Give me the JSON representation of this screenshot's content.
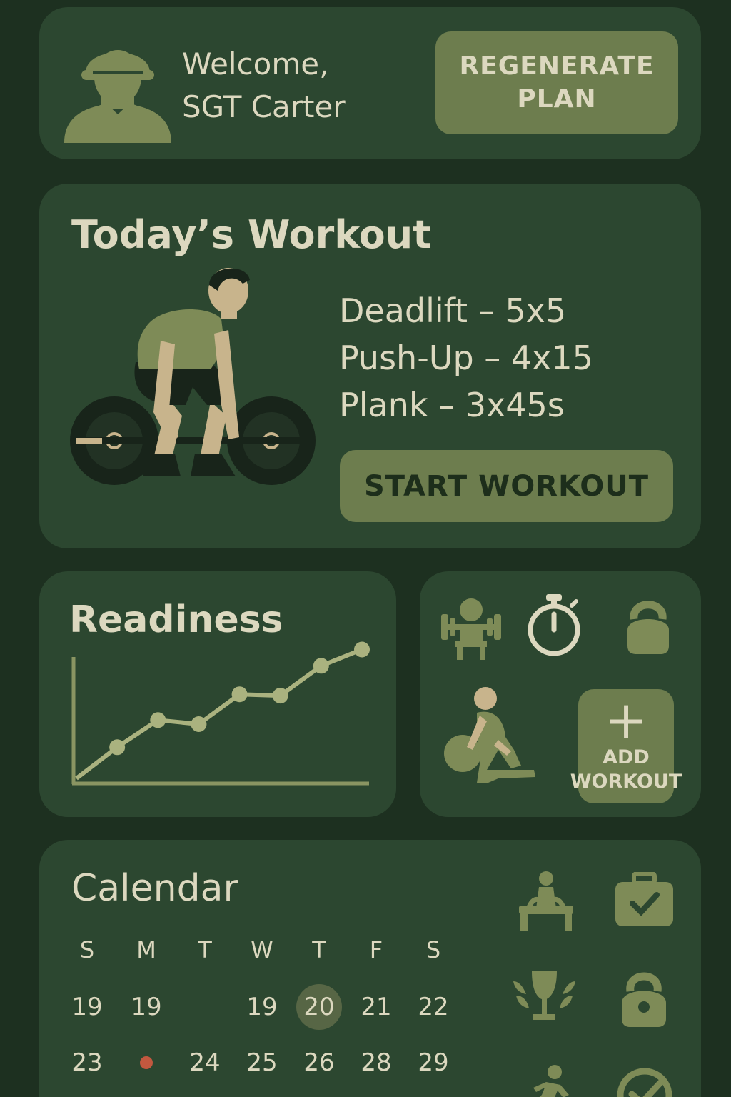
{
  "header": {
    "welcome_line1": "Welcome,",
    "welcome_line2": "SGT Carter",
    "regenerate_line1": "REGENERATE",
    "regenerate_line2": "PLAN",
    "avatar_icon": "soldier-avatar-icon"
  },
  "workout": {
    "title": "Today’s Workout",
    "exercises": [
      "Deadlift – 5x5",
      "Push-Up – 4x15",
      "Plank – 3x45s"
    ],
    "start_label": "START WORKOUT",
    "illustration_icon": "deadlift-figure-icon"
  },
  "readiness": {
    "title": "Readiness"
  },
  "chart_data": {
    "type": "line",
    "title": "Readiness",
    "xlabel": "",
    "ylabel": "",
    "x": [
      0,
      1,
      2,
      3,
      4,
      5,
      6,
      7
    ],
    "values": [
      0,
      2.3,
      4.3,
      4.0,
      6.2,
      6.1,
      8.3,
      9.5
    ],
    "ylim": [
      0,
      10
    ],
    "grid": false,
    "markers": [
      false,
      true,
      true,
      true,
      true,
      true,
      true,
      true
    ]
  },
  "quick_actions": {
    "icons": [
      "bench-press-icon",
      "stopwatch-icon",
      "kettlebell-icon",
      "kettlebell-lunge-icon"
    ],
    "add_line1": "ADD",
    "add_line2": "WORKOUT"
  },
  "calendar": {
    "title": "Calendar",
    "weekdays": [
      "S",
      "M",
      "T",
      "W",
      "T",
      "F",
      "S"
    ],
    "row1": [
      "19",
      "19",
      "",
      "19",
      "20",
      "21",
      "22"
    ],
    "row2": [
      "23",
      "",
      "24",
      "25",
      "26",
      "28",
      "29"
    ],
    "today": "20",
    "event_dot_color": "#c2583f",
    "side_icons": [
      "pull-up-icon",
      "medical-kit-icon",
      "trophy-icon",
      "kettlebell-icon",
      "runner-icon",
      "checklist-icon"
    ]
  },
  "colors": {
    "background": "#1d3020",
    "card": "#2c4730",
    "accent": "#6d7d4e",
    "text": "#dcd8bf",
    "icon": "#7e8b57"
  }
}
